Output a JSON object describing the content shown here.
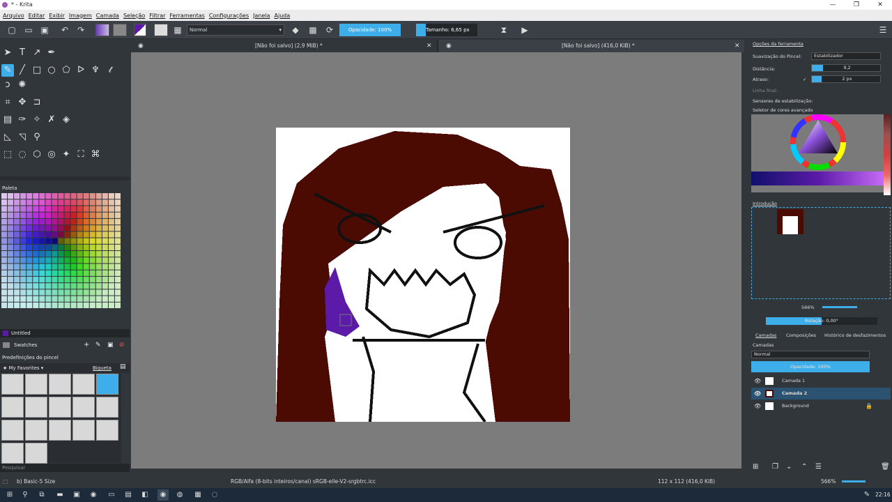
{
  "window": {
    "title": "* - Krita"
  },
  "menu": [
    "Arquivo",
    "Editar",
    "Exibir",
    "Imagem",
    "Camada",
    "Seleção",
    "Filtrar",
    "Ferramentas",
    "Configurações",
    "Janela",
    "Ajuda"
  ],
  "toolbar": {
    "blend_mode": "Normal",
    "opacity": "Opacidade: 100%",
    "size": "Tamanho: 6,65 px"
  },
  "tabs": [
    {
      "label": "[Não foi salvo]  (2,9 MiB) *"
    },
    {
      "label": "[Não foi salvo]  (416,0 KiB) *"
    }
  ],
  "left": {
    "palette_title": "Paleta",
    "palette_name": "Untitled",
    "swatches": "Swatches",
    "presets_title": "Predefinições do pincel",
    "presets_tag": "My Favorites",
    "presets_view": "Bigueta",
    "search_placeholder": "Pesquisar"
  },
  "right": {
    "tool_options_title": "Opções da ferramenta",
    "smoothing_label": "Suavização do Pincel:",
    "smoothing_value": "Estabilizador",
    "distance_label": "Distância:",
    "distance_value": "9,2",
    "delay_label": "Atraso:",
    "delay_value": "2 px",
    "finish_line_label": "Linha final:",
    "stabilize_sensors_label": "Sensores de estabilização:",
    "color_selector_title": "Seletor de cores avançado",
    "overview_title": "Introdução",
    "zoom_value": "566%",
    "rotation": "Rotação: 0,00°",
    "layer_tabs": [
      "Camadas",
      "Composições",
      "Histórico de desfazimentos"
    ],
    "layers_title": "Camadas",
    "layer_blend": "Normal",
    "layer_opacity": "Opacidade:  100%",
    "layers": [
      {
        "name": "Camada 1"
      },
      {
        "name": "Camada 2"
      },
      {
        "name": "Background"
      }
    ]
  },
  "status": {
    "brush": "b) Basic-5 Size",
    "colorspace": "RGB/Alfa (8-bits inteiros/canal)  sRGB-elle-V2-srgbtrc.icc",
    "dimensions": "112 x 112 (416,0 KiB)",
    "zoom": "566%"
  },
  "taskbar": {
    "time": "22:16"
  },
  "colors": {
    "accent": "#3daee9",
    "hair": "#4b0b02",
    "purple": "#5b1aa8",
    "panel": "#31363b"
  }
}
